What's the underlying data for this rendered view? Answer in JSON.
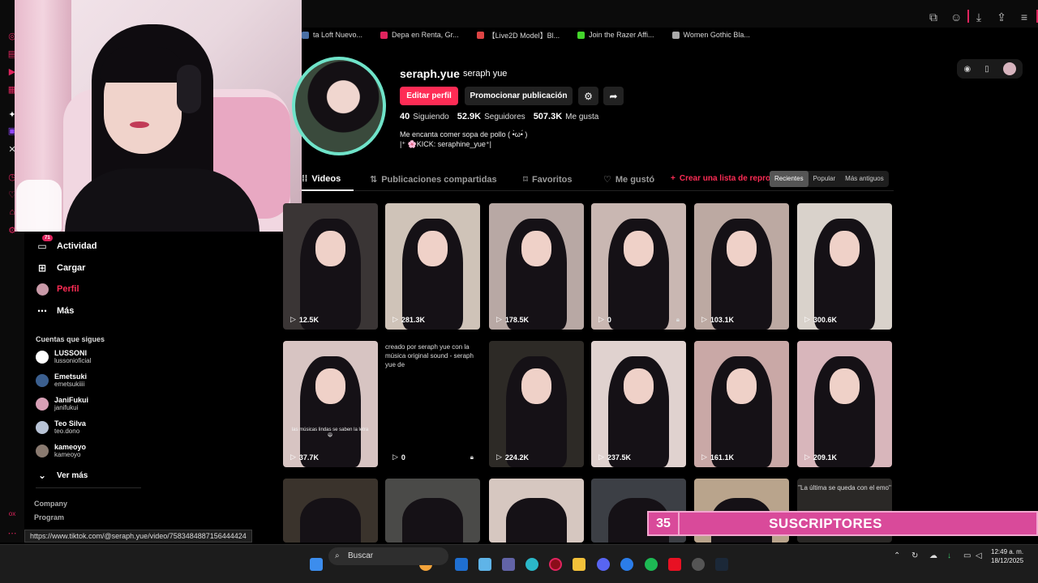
{
  "bookmarks": [
    {
      "label": "ta Loft Nuevo...",
      "color": "#4a6fa5"
    },
    {
      "label": "Depa en Renta, Gr...",
      "color": "#e0245e"
    },
    {
      "label": "【Live2D Model】Bl...",
      "color": "#d44"
    },
    {
      "label": "Join the Razer Affi...",
      "color": "#44d62c"
    },
    {
      "label": "Women Gothic Bla...",
      "color": "#aaa"
    }
  ],
  "nav": {
    "activity": "Actividad",
    "activity_badge": "71",
    "upload": "Cargar",
    "profile": "Perfil",
    "more": "Más",
    "following_title": "Cuentas que sigues",
    "following": [
      {
        "name": "LUSSONI",
        "handle": "lussonioficial",
        "color": "#ffffff"
      },
      {
        "name": "Emetsuki",
        "handle": "emetsukiiii",
        "color": "#3b5f8f"
      },
      {
        "name": "JaniFukui",
        "handle": "janifukui",
        "color": "#d79fb5"
      },
      {
        "name": "Teo Silva",
        "handle": "teo.dono",
        "color": "#b8c3d6"
      },
      {
        "name": "kameoyo",
        "handle": "kameoyo",
        "color": "#8a7a70"
      }
    ],
    "see_more": "Ver más",
    "footer_company": "Company",
    "footer_program": "Program"
  },
  "profile": {
    "username": "seraph.yue",
    "nickname": "seraph yue",
    "edit_button": "Editar perfil",
    "promote_button": "Promocionar publicación",
    "following_count": "40",
    "following_label": "Siguiendo",
    "followers_count": "52.9K",
    "followers_label": "Seguidores",
    "likes_count": "507.3K",
    "likes_label": "Me gusta",
    "bio_line1": "Me encanta comer sopa de pollo ( •̀ω•́ )",
    "bio_line2": "|⁺ 🌸KICK: seraphine_yue⁺|"
  },
  "tabs": {
    "videos": "Videos",
    "reposts": "Publicaciones compartidas",
    "favorites": "Favoritos",
    "liked": "Me gustó",
    "create_playlist": "Crear una lista de reprod"
  },
  "sort": {
    "recent": "Recientes",
    "popular": "Popular",
    "oldest": "Más antiguos"
  },
  "videos": [
    {
      "views": "12.5K",
      "bg": "#3a3535",
      "locked": false
    },
    {
      "views": "281.3K",
      "bg": "#cfc3b8",
      "locked": false
    },
    {
      "views": "178.5K",
      "bg": "#b8a8a4",
      "locked": false
    },
    {
      "views": "0",
      "bg": "#c9b7b2",
      "locked": true
    },
    {
      "views": "103.1K",
      "bg": "#bca9a2",
      "locked": false
    },
    {
      "views": "300.6K",
      "bg": "#d9d2cb",
      "locked": false
    },
    {
      "views": "37.7K",
      "bg": "#d7c4c2",
      "locked": false,
      "subcaption": "las músicas lindas se saben la letra 😆"
    },
    {
      "views": "0",
      "bg": "#000000",
      "locked": true,
      "alt": "creado por seraph yue con la música original sound - seraph yue de"
    },
    {
      "views": "224.2K",
      "bg": "#2d2a26",
      "locked": false
    },
    {
      "views": "237.5K",
      "bg": "#e0d2cf",
      "locked": false
    },
    {
      "views": "161.1K",
      "bg": "#c9a8a6",
      "locked": false
    },
    {
      "views": "209.1K",
      "bg": "#d8b6bb",
      "locked": false
    }
  ],
  "videos_row3": [
    {
      "bg": "#3a332c"
    },
    {
      "bg": "#4a4a48"
    },
    {
      "bg": "#d6c7c0"
    },
    {
      "bg": "#3c3f45"
    },
    {
      "bg": "#b9a48c"
    },
    {
      "bg": "#2a2826",
      "text": "\"La última se queda con el emo\""
    }
  ],
  "overlay": {
    "count": "35",
    "label": "SUSCRIPTORES"
  },
  "status_url": "https://www.tiktok.com/@seraph.yue/video/7583484887156444424",
  "taskbar": {
    "search": "Buscar",
    "time": "12:49 a. m.",
    "date": "18/12/2025"
  }
}
